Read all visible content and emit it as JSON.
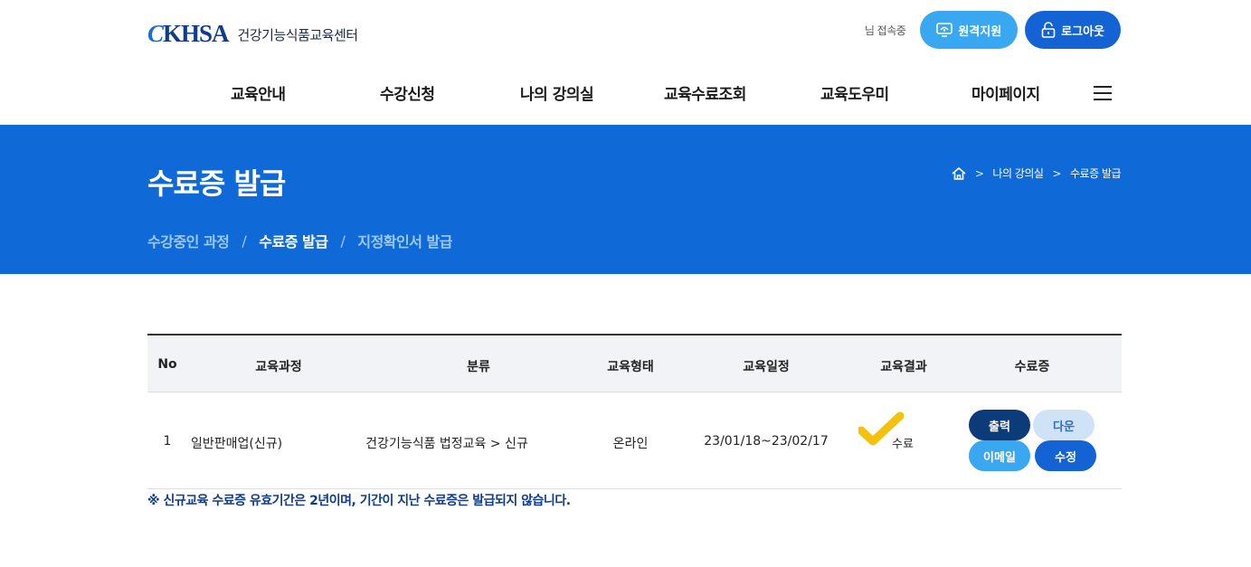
{
  "header": {
    "logo_mark": "KHSA",
    "logo_text": "건강기능식품교육센터",
    "status_text": "님 접속중",
    "remote_support_label": "원격지원",
    "logout_label": "로그아웃"
  },
  "nav": {
    "items": [
      "교육안내",
      "수강신청",
      "나의 강의실",
      "교육수료조회",
      "교육도우미",
      "마이페이지"
    ],
    "menu_icon": "hamburger-icon"
  },
  "banner": {
    "title": "수료증 발급",
    "breadcrumb": [
      "나의 강의실",
      "수료증 발급"
    ],
    "home_icon": "home-icon",
    "subtabs": [
      "수강중인 과정",
      "수료증 발급",
      "지정확인서 발급"
    ],
    "active_subtab": "수료증 발급"
  },
  "table": {
    "columns": [
      "No",
      "교육과정",
      "분류",
      "교육형태",
      "교육일정",
      "교육결과",
      "수료증"
    ],
    "rows": [
      {
        "no": "1",
        "course": "일반판매업(신규)",
        "category": "건강기능식품 법정교육 > 신규",
        "type": "온라인",
        "schedule": "23/01/18~23/02/17",
        "result": "수료",
        "actions": {
          "print": "출력",
          "download": "다운",
          "email": "이메일",
          "edit": "수정"
        }
      }
    ]
  },
  "notice": "※ 신규교육 수료증 유효기간은 2년이며, 기간이 지난 수료증은 발급되지 않습니다.",
  "colors": {
    "brand_blue": "#0f6ad8",
    "navy": "#0c3b7a",
    "sky": "#3aa8f0",
    "check_yellow": "#f4c20d"
  }
}
